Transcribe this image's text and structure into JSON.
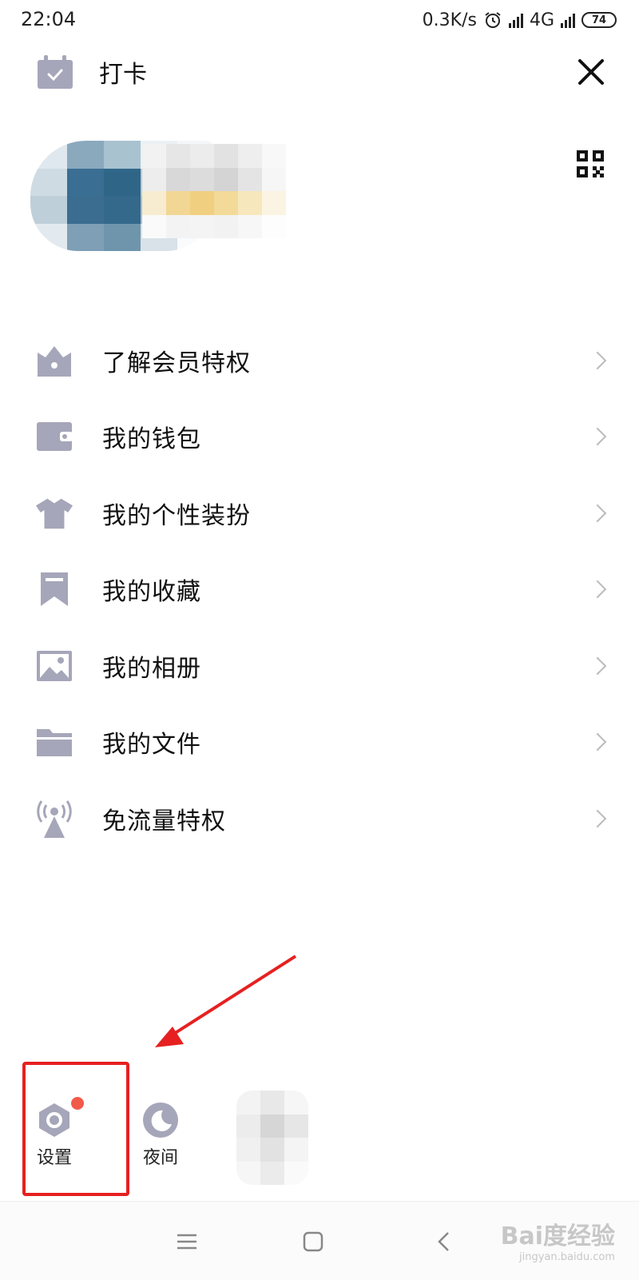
{
  "status_bar": {
    "time": "22:04",
    "speed": "0.3K/s",
    "network": "4G",
    "battery": "74"
  },
  "top_bar": {
    "checkin_label": "打卡"
  },
  "menu": [
    {
      "label": "了解会员特权",
      "icon": "crown-icon"
    },
    {
      "label": "我的钱包",
      "icon": "wallet-icon"
    },
    {
      "label": "我的个性装扮",
      "icon": "tshirt-icon"
    },
    {
      "label": "我的收藏",
      "icon": "bookmark-icon"
    },
    {
      "label": "我的相册",
      "icon": "photo-icon"
    },
    {
      "label": "我的文件",
      "icon": "folder-icon"
    },
    {
      "label": "免流量特权",
      "icon": "signal-tower-icon"
    }
  ],
  "bottom_actions": {
    "settings_label": "设置",
    "night_label": "夜间"
  },
  "watermark": {
    "line1": "Bai度经验",
    "line2": "jingyan.baidu.com"
  },
  "colors": {
    "icon": "#a6a6ba",
    "badge": "#f25a4a",
    "highlight": "#e62020",
    "arrow": "#e62020"
  }
}
